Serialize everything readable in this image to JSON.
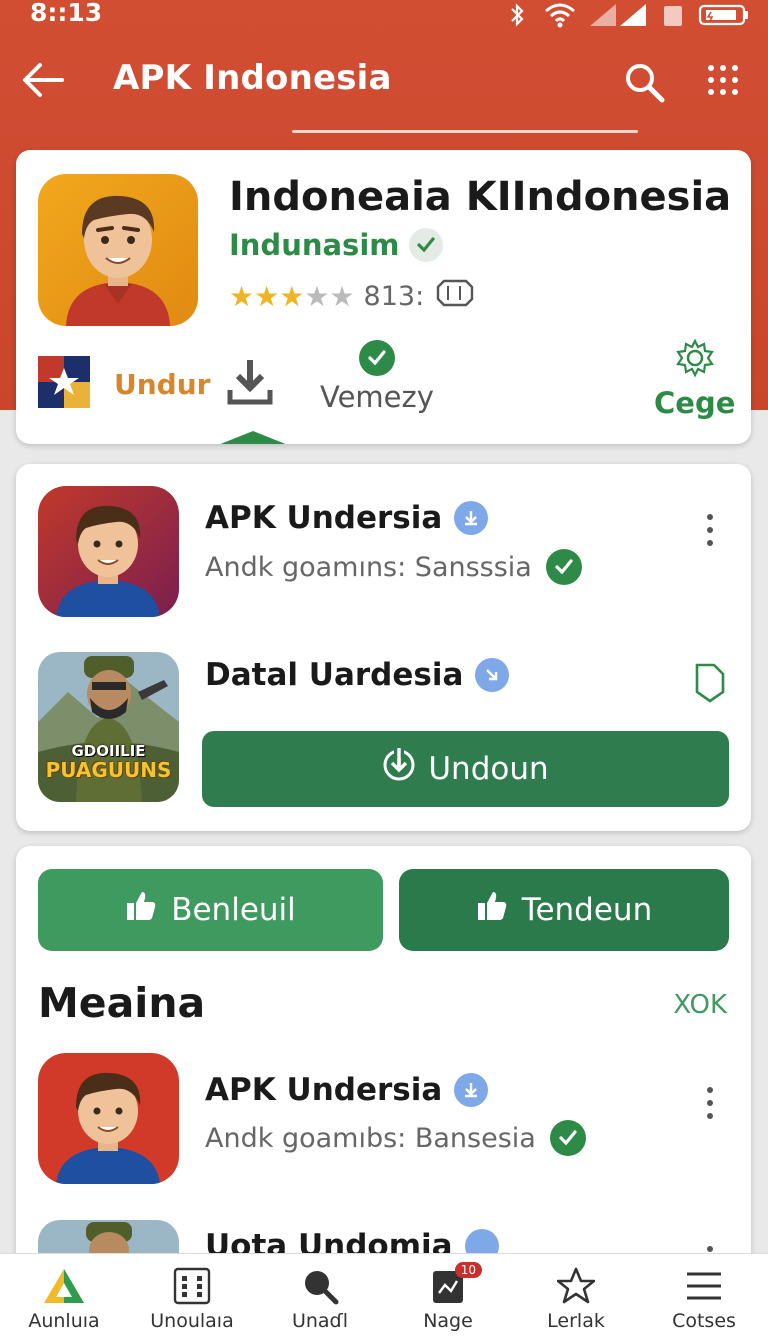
{
  "status": {
    "time": "8::13"
  },
  "appbar": {
    "title": "APK Indonesia"
  },
  "hero": {
    "title": "Indoneaia KIIndonesia",
    "developer": "Indunasim",
    "rating_value": 3,
    "rating_max": 5,
    "rating_text": "813:",
    "actions": [
      {
        "label": "Undur"
      },
      {
        "label": "Vemezy"
      },
      {
        "label": "Cege"
      }
    ]
  },
  "list1": [
    {
      "title": "APK Undersia",
      "subtitle": "Andk goamıns: Sansssia"
    },
    {
      "title": "Datal Uardesia",
      "button_label": "Undoun"
    }
  ],
  "game_icon_text": [
    "GDOIILIE",
    "PUAGUUNS"
  ],
  "pills": {
    "left": "Benleuil",
    "right": "Tendeun"
  },
  "section": {
    "title": "Meaina",
    "more": "XOK"
  },
  "list2": [
    {
      "title": "APK Undersia",
      "subtitle": "Andk goamıbs: Bansesia"
    },
    {
      "title": "Uota Undomia"
    }
  ],
  "bottom_nav": [
    {
      "label": "Aunluıa",
      "icon": "home-icon"
    },
    {
      "label": "Unoulaıa",
      "icon": "apps-grid-icon"
    },
    {
      "label": "Unaɗl",
      "icon": "search-icon"
    },
    {
      "label": "Nage",
      "icon": "updates-icon",
      "badge": "10"
    },
    {
      "label": "Lerlak",
      "icon": "star-icon"
    },
    {
      "label": "Cotses",
      "icon": "menu-icon"
    }
  ],
  "colors": {
    "header": "#d24e33",
    "accent_green": "#2e8b47",
    "button_green": "#2f7d4f",
    "star": "#f0b323"
  }
}
